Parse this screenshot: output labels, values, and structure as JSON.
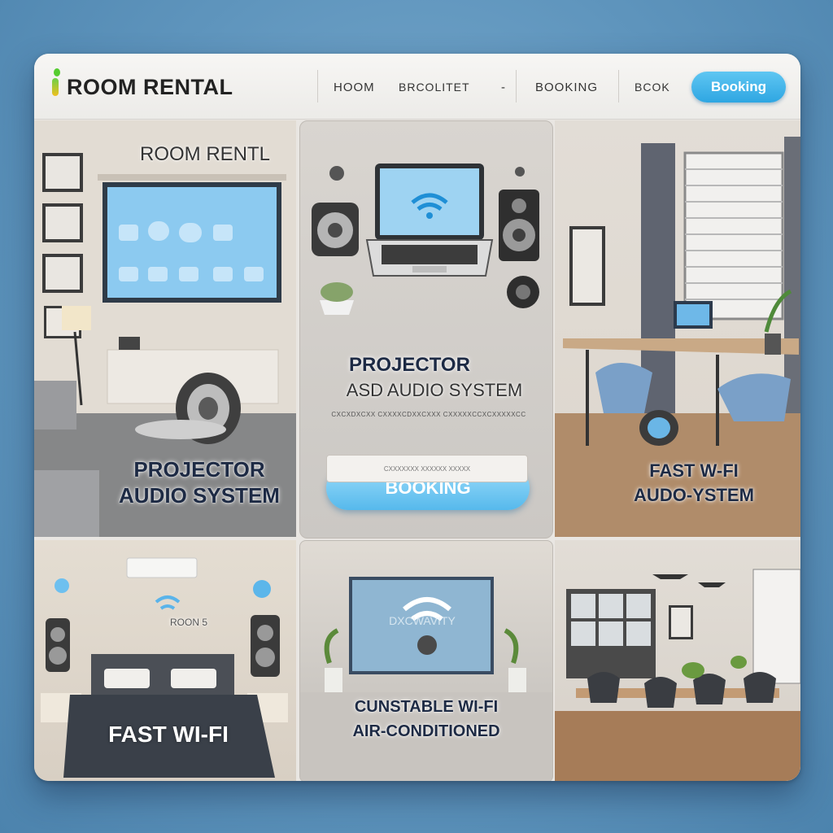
{
  "header": {
    "logo": "ROOM RENTAL",
    "nav": [
      "HOOM",
      "BRCOLITET",
      "-",
      "BOOKING",
      "BCOK"
    ],
    "cta": "Booking"
  },
  "panels": {
    "p1": {
      "sign": "ROOM RENTL",
      "label1": "PROJECTOR",
      "label2": "AUDIO SYSTEM"
    },
    "p2": {
      "title1": "PROJECTOR",
      "title2": "ASD AUDIO SYSTEM",
      "caption": "CXCXDXCXX CXXXXCDXXCXXX CXXXXXCCXCXXXXXCC",
      "button": "BOOKING",
      "input": "CXXXXXXX XXXXXX XXXXX"
    },
    "p3": {
      "label1": "FAST W-FI",
      "label2": "AUDO-YSTEM"
    },
    "p4": {
      "sign": "ROON 5",
      "label": "FAST WI-FI"
    },
    "p5": {
      "screen": "DXCWAVITY",
      "label1": "CUNSTABLE WI-FI",
      "label2": "AIR-CONDITIONED"
    },
    "p6": {}
  },
  "colors": {
    "accent": "#3aaee6",
    "label_text": "#1d2a44",
    "background": "#5f95bd"
  }
}
